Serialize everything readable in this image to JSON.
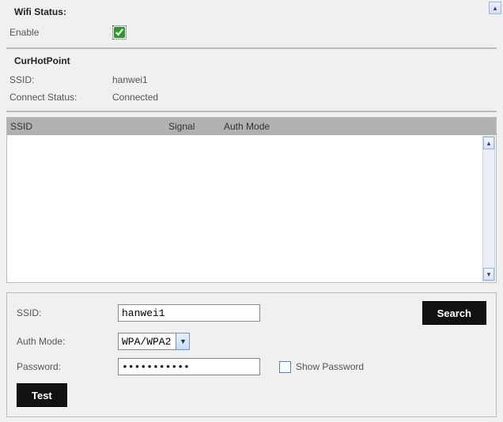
{
  "wifi_status": {
    "title": "Wifi Status:",
    "enable_label": "Enable",
    "enabled": true
  },
  "hotpoint": {
    "title": "CurHotPoint",
    "ssid_label": "SSID:",
    "ssid_value": "hanwei1",
    "connect_label": "Connect Status:",
    "connect_value": "Connected"
  },
  "list": {
    "headers": {
      "ssid": "SSID",
      "signal": "Signal",
      "auth": "Auth Mode"
    },
    "rows": []
  },
  "form": {
    "ssid_label": "SSID:",
    "ssid_value": "hanwei1",
    "auth_label": "Auth Mode:",
    "auth_value": "WPA/WPA2",
    "password_label": "Password:",
    "password_value": "•••••••••••",
    "show_password_label": "Show Password",
    "show_password_checked": false,
    "search_label": "Search",
    "test_label": "Test"
  }
}
